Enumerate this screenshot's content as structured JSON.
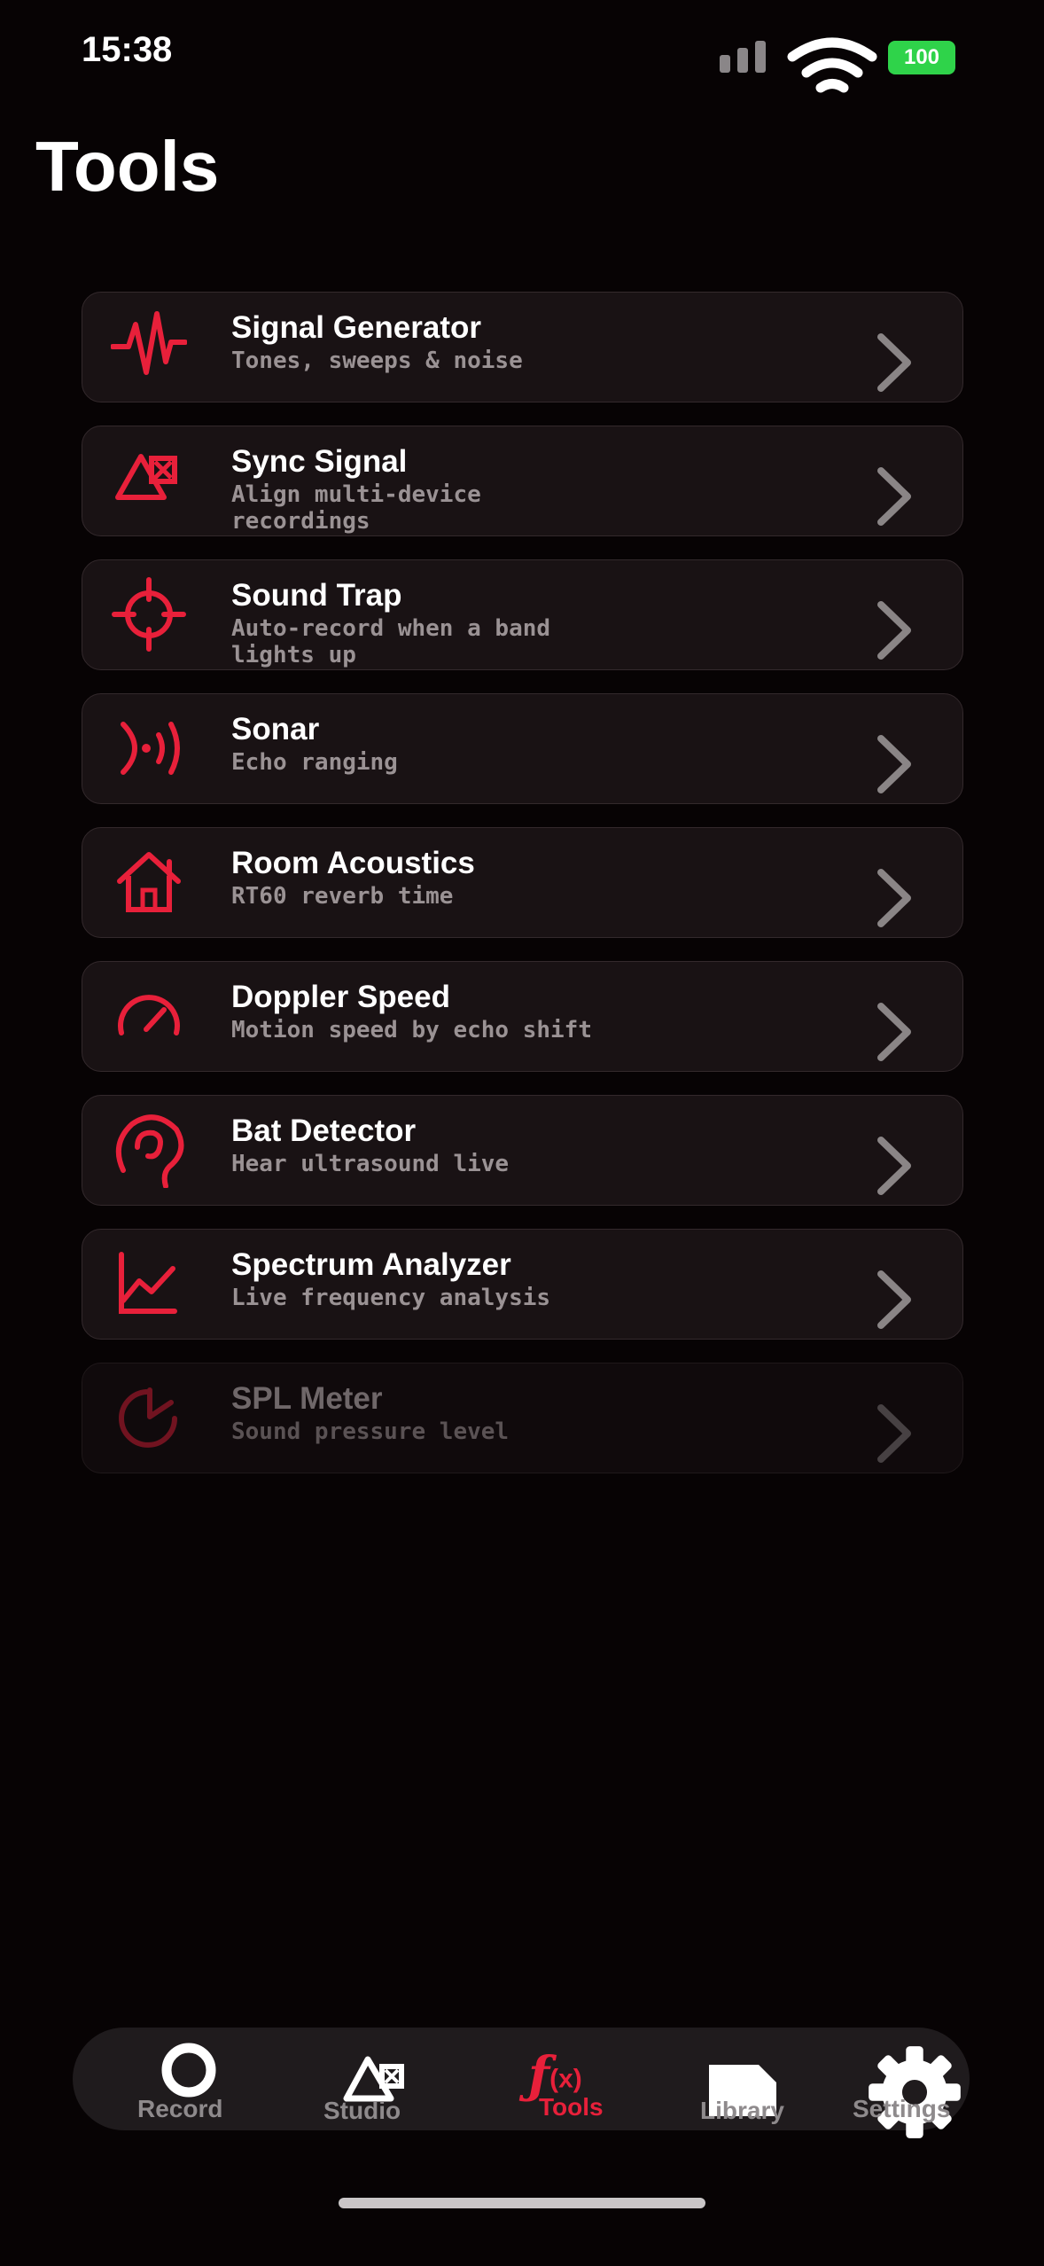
{
  "status_bar": {
    "time": "15:38",
    "battery": "100",
    "icons": [
      "cellular-signal-icon",
      "wifi-icon",
      "battery-icon"
    ],
    "battery_color": "#2fd34a"
  },
  "header": {
    "title": "Tools"
  },
  "colors": {
    "accent": "#e8203a",
    "background": "#070304",
    "card": "#191214"
  },
  "tools": [
    {
      "title": "Signal Generator",
      "subtitle": "Tones, sweeps & noise",
      "icon": "waveform-icon",
      "enabled": true
    },
    {
      "title": "Sync Signal",
      "subtitle": "Align multi-device recordings",
      "icon": "sync-triangle-icon",
      "enabled": true
    },
    {
      "title": "Sound Trap",
      "subtitle": "Auto-record when a band lights up",
      "icon": "crosshair-icon",
      "enabled": true
    },
    {
      "title": "Sonar",
      "subtitle": "Echo ranging",
      "icon": "sonar-waves-icon",
      "enabled": true
    },
    {
      "title": "Room Acoustics",
      "subtitle": "RT60 reverb time",
      "icon": "house-icon",
      "enabled": true
    },
    {
      "title": "Doppler Speed",
      "subtitle": "Motion speed by echo shift",
      "icon": "speedometer-icon",
      "enabled": true
    },
    {
      "title": "Bat Detector",
      "subtitle": "Hear ultrasound live",
      "icon": "ear-icon",
      "enabled": true
    },
    {
      "title": "Spectrum Analyzer",
      "subtitle": "Live frequency analysis",
      "icon": "line-chart-icon",
      "enabled": true
    },
    {
      "title": "SPL Meter",
      "subtitle": "Sound pressure level",
      "icon": "pie-gauge-icon",
      "enabled": false
    }
  ],
  "tab_bar": {
    "active": "Tools",
    "tabs": [
      {
        "label": "Record",
        "icon": "record-circle-icon"
      },
      {
        "label": "Studio",
        "icon": "studio-triangle-icon"
      },
      {
        "label": "Tools",
        "icon": "function-icon"
      },
      {
        "label": "Library",
        "icon": "folder-icon"
      },
      {
        "label": "Settings",
        "icon": "gear-icon"
      }
    ]
  }
}
